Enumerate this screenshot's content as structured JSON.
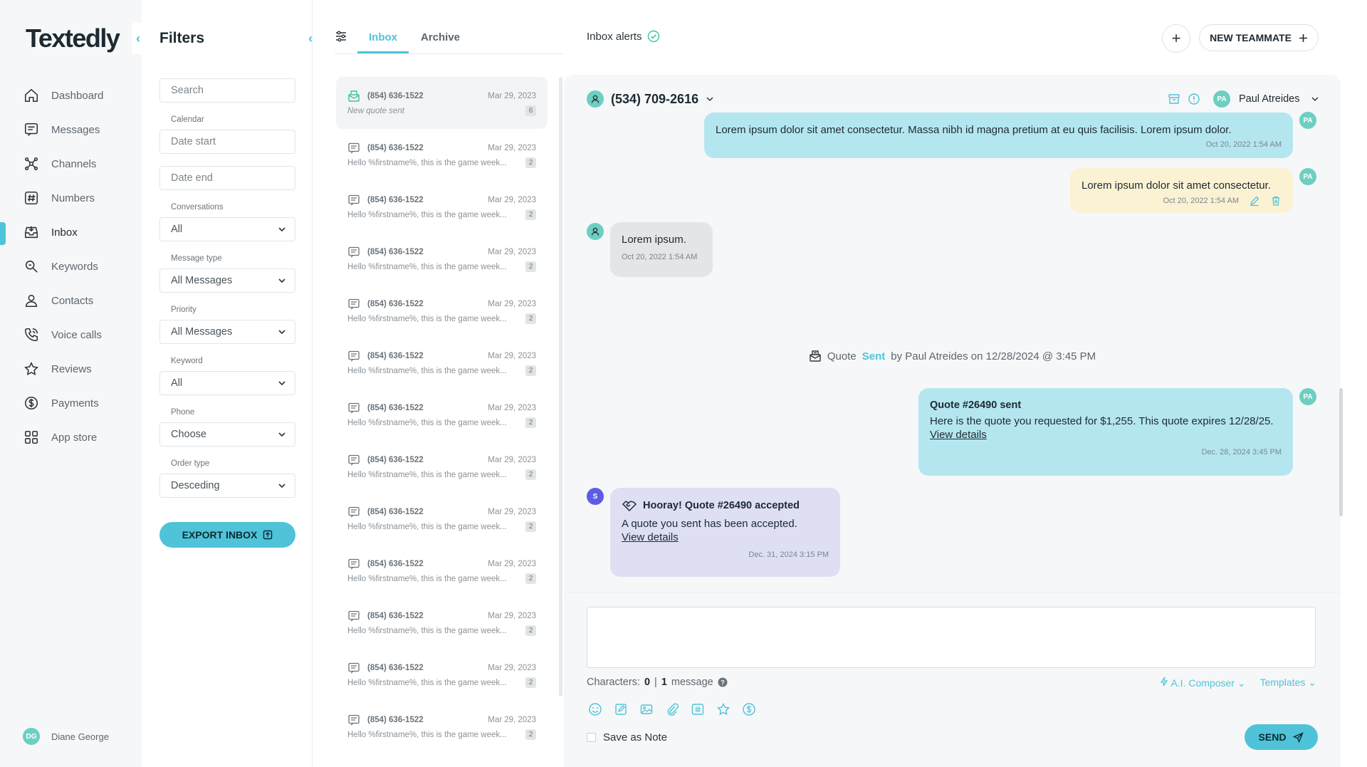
{
  "brand": {
    "logo": "Textedly",
    "accent": "#4fc3d8"
  },
  "nav": {
    "items": [
      {
        "label": "Dashboard",
        "icon": "home-icon"
      },
      {
        "label": "Messages",
        "icon": "message-icon"
      },
      {
        "label": "Channels",
        "icon": "channels-icon"
      },
      {
        "label": "Numbers",
        "icon": "hash-icon"
      },
      {
        "label": "Inbox",
        "icon": "inbox-icon",
        "active": true
      },
      {
        "label": "Keywords",
        "icon": "keyword-icon"
      },
      {
        "label": "Contacts",
        "icon": "contact-icon"
      },
      {
        "label": "Voice calls",
        "icon": "phone-icon"
      },
      {
        "label": "Reviews",
        "icon": "star-icon"
      },
      {
        "label": "Payments",
        "icon": "dollar-icon"
      },
      {
        "label": "App store",
        "icon": "grid-icon"
      }
    ],
    "user": {
      "initials": "DG",
      "name": "Diane George"
    }
  },
  "filters": {
    "title": "Filters",
    "search_placeholder": "Search",
    "calendar_label": "Calendar",
    "date_start_placeholder": "Date start",
    "date_end_placeholder": "Date end",
    "conversations_label": "Conversations",
    "conversations_value": "All",
    "message_type_label": "Message type",
    "message_type_value": "All Messages",
    "priority_label": "Priority",
    "priority_value": "All Messages",
    "keyword_label": "Keyword",
    "keyword_value": "All",
    "phone_label": "Phone",
    "phone_value": "Choose",
    "order_type_label": "Order type",
    "order_type_value": "Desceding",
    "export_label": "EXPORT INBOX"
  },
  "inbox": {
    "tabs": [
      "Inbox",
      "Archive"
    ],
    "messages": [
      {
        "phone": "(854) 636-1522",
        "date": "Mar 29, 2023",
        "preview": "New quote sent",
        "count": "6",
        "type": "quote"
      },
      {
        "phone": "(854) 636-1522",
        "date": "Mar 29, 2023",
        "preview": "Hello %firstname%, this is the game week...",
        "count": "2",
        "type": "message"
      },
      {
        "phone": "(854) 636-1522",
        "date": "Mar 29, 2023",
        "preview": "Hello %firstname%, this is the game week...",
        "count": "2",
        "type": "message"
      },
      {
        "phone": "(854) 636-1522",
        "date": "Mar 29, 2023",
        "preview": "Hello %firstname%, this is the game week...",
        "count": "2",
        "type": "message"
      },
      {
        "phone": "(854) 636-1522",
        "date": "Mar 29, 2023",
        "preview": "Hello %firstname%, this is the game week...",
        "count": "2",
        "type": "message"
      },
      {
        "phone": "(854) 636-1522",
        "date": "Mar 29, 2023",
        "preview": "Hello %firstname%, this is the game week...",
        "count": "2",
        "type": "message"
      },
      {
        "phone": "(854) 636-1522",
        "date": "Mar 29, 2023",
        "preview": "Hello %firstname%, this is the game week...",
        "count": "2",
        "type": "message"
      },
      {
        "phone": "(854) 636-1522",
        "date": "Mar 29, 2023",
        "preview": "Hello %firstname%, this is the game week...",
        "count": "2",
        "type": "message"
      },
      {
        "phone": "(854) 636-1522",
        "date": "Mar 29, 2023",
        "preview": "Hello %firstname%, this is the game week...",
        "count": "2",
        "type": "message"
      },
      {
        "phone": "(854) 636-1522",
        "date": "Mar 29, 2023",
        "preview": "Hello %firstname%, this is the game week...",
        "count": "2",
        "type": "message"
      },
      {
        "phone": "(854) 636-1522",
        "date": "Mar 29, 2023",
        "preview": "Hello %firstname%, this is the game week...",
        "count": "2",
        "type": "message"
      },
      {
        "phone": "(854) 636-1522",
        "date": "Mar 29, 2023",
        "preview": "Hello %firstname%, this is the game week...",
        "count": "2",
        "type": "message"
      },
      {
        "phone": "(854) 636-1522",
        "date": "Mar 29, 2023",
        "preview": "Hello %firstname%, this is the game week...",
        "count": "2",
        "type": "message"
      }
    ]
  },
  "header": {
    "inbox_alerts": "Inbox alerts",
    "add_symbol": "+",
    "new_teammate": "NEW TEAMMATE"
  },
  "conversation": {
    "phone": "(534) 709-2616",
    "assignee_initials": "PA",
    "assignee": "Paul Atreides",
    "bubbles": {
      "out1_text": "Lorem ipsum dolor sit amet consectetur. Massa nibh id magna pretium at eu quis facilisis. Lorem ipsum dolor.",
      "out1_time": "Oct 20, 2022 1:54 AM",
      "note_text": "Lorem ipsum dolor sit amet consectetur.",
      "note_time": "Oct 20, 2022 1:54 AM",
      "in_text": "Lorem ipsum.",
      "in_time": "Oct 20, 2022 1:54 AM",
      "sys_quote": "Quote",
      "sys_sent": "Sent",
      "sys_rest": "by Paul Atreides on 12/28/2024 @ 3:45 PM",
      "quote_title": "Quote #26490 sent",
      "quote_text": "Here is the quote you requested for $1,255. This quote expires 12/28/25.",
      "quote_link": "View details",
      "quote_time": "Dec. 28, 2024 3:45 PM",
      "accepted_avatar": "S",
      "accepted_title": "Hooray! Quote #26490 accepted",
      "accepted_text": "A quote you sent has been accepted.",
      "accepted_link": "View details",
      "accepted_time": "Dec. 31, 2024 3:15 PM"
    }
  },
  "composer": {
    "chars_label": "Characters:",
    "chars_count": "0",
    "separator": "|",
    "msg_count": "1",
    "msg_label": "message",
    "ai_composer": "A.I. Composer",
    "templates": "Templates",
    "save_note": "Save as Note",
    "send": "SEND"
  }
}
